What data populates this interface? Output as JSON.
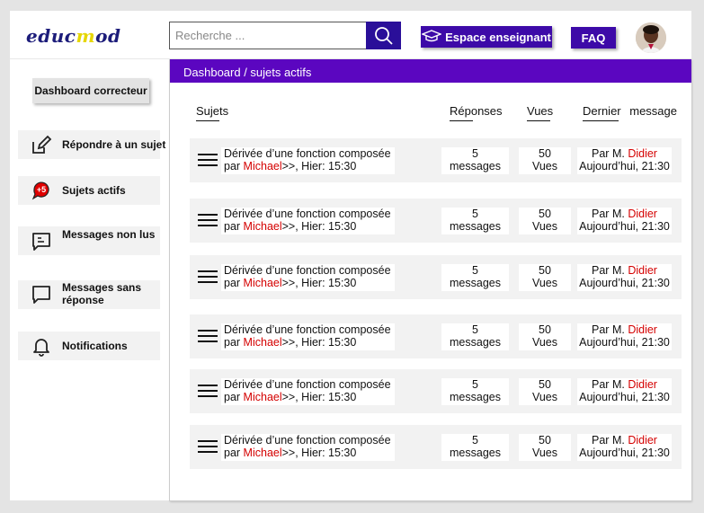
{
  "header": {
    "logo": {
      "part1": "educ",
      "part2": "m",
      "part3": "od"
    },
    "search_placeholder": "Recherche ...",
    "teacher_button": "Espace enseignant",
    "faq_button": "FAQ"
  },
  "sidebar": {
    "corrector_button": "Dashboard correcteur",
    "items": [
      {
        "label": "Répondre à  un sujet",
        "icon": "edit-icon"
      },
      {
        "label": "Sujets actifs",
        "icon": "chat-badge-icon",
        "badge": "+5"
      },
      {
        "label": "Messages non lus",
        "icon": "message-icon"
      },
      {
        "label": "Messages sans réponse",
        "icon": "chat-bubble-icon"
      },
      {
        "label": "Notifications",
        "icon": "bell-icon"
      }
    ]
  },
  "main": {
    "breadcrumb": "Dashboard / sujets actifs",
    "columns": {
      "subjects": "Sujets",
      "replies": "Réponses",
      "views": "Vues",
      "last_a": "Dernier",
      "last_b": "message"
    },
    "rows": [
      {
        "title": "Dérivée d’une fonction composée",
        "by": "par ",
        "author": "Michael",
        "when": ">>, Hier: 15:30",
        "replies_n": "5",
        "replies_unit": "messages",
        "views_n": "50",
        "views_unit": "Vues",
        "last_by": "Par M. ",
        "last_author": "Didier",
        "last_when": "Aujourd’hui, 21:30"
      },
      {
        "title": "Dérivée d’une fonction composée",
        "by": "par ",
        "author": "Michael",
        "when": ">>, Hier: 15:30",
        "replies_n": "5",
        "replies_unit": "messages",
        "views_n": "50",
        "views_unit": "Vues",
        "last_by": "Par M. ",
        "last_author": "Didier",
        "last_when": "Aujourd’hui, 21:30"
      },
      {
        "title": "Dérivée d’une fonction composée",
        "by": "par ",
        "author": "Michael",
        "when": ">>, Hier: 15:30",
        "replies_n": "5",
        "replies_unit": "messages",
        "views_n": "50",
        "views_unit": "Vues",
        "last_by": "Par M. ",
        "last_author": "Didier",
        "last_when": "Aujourd’hui, 21:30"
      },
      {
        "title": "Dérivée d’une fonction composée",
        "by": "par ",
        "author": "Michael",
        "when": ">>, Hier: 15:30",
        "replies_n": "5",
        "replies_unit": "messages",
        "views_n": "50",
        "views_unit": "Vues",
        "last_by": "Par M. ",
        "last_author": "Didier",
        "last_when": "Aujourd’hui, 21:30"
      },
      {
        "title": "Dérivée d’une fonction composée",
        "by": "par ",
        "author": "Michael",
        "when": ">>, Hier: 15:30",
        "replies_n": "5",
        "replies_unit": "messages",
        "views_n": "50",
        "views_unit": "Vues",
        "last_by": "Par M. ",
        "last_author": "Didier",
        "last_when": "Aujourd’hui, 21:30"
      },
      {
        "title": "Dérivée d’une fonction composée",
        "by": "par ",
        "author": "Michael",
        "when": ">>, Hier: 15:30",
        "replies_n": "5",
        "replies_unit": "messages",
        "views_n": "50",
        "views_unit": "Vues",
        "last_by": "Par M. ",
        "last_author": "Didier",
        "last_when": "Aujourd’hui, 21:30"
      }
    ]
  },
  "colors": {
    "accent": "#5b06c0",
    "button": "#3d0aa8",
    "highlight": "#d40000"
  }
}
